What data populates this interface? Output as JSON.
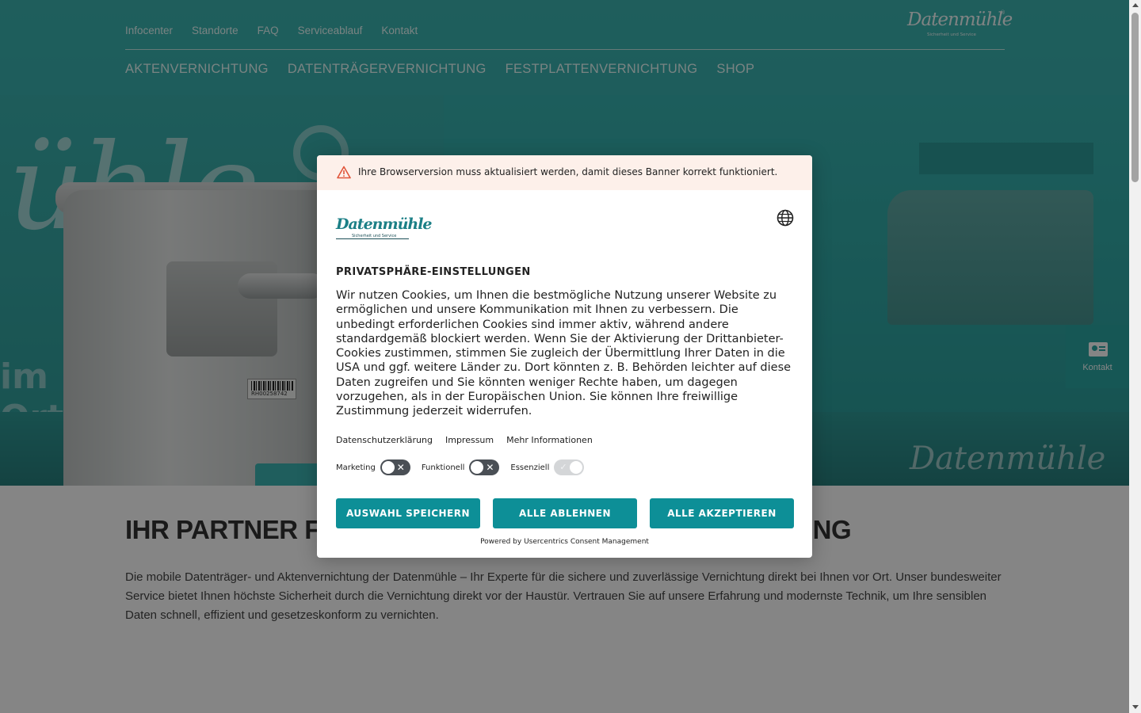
{
  "header": {
    "meta_nav": [
      "Infocenter",
      "Standorte",
      "FAQ",
      "Serviceablauf",
      "Kontakt"
    ],
    "main_nav": [
      "AKTENVERNICHTUNG",
      "DATENTRÄGERVERNICHTUNG",
      "FESTPLATTENVERNICHTUNG",
      "SHOP"
    ],
    "logo": {
      "name": "Datenmühle",
      "tagline": "Sicherheit und Service",
      "reg": "®"
    }
  },
  "hero": {
    "brand_script": "ühle",
    "brand_small": "Datenmühle",
    "side_text": [
      "im U",
      "Ort in"
    ],
    "barcode_text": "RH00258742"
  },
  "content": {
    "title": "IHR PARTNER FÜR MOBILE DATENTRÄGERVERNICHTUNG",
    "text": "Die mobile Datenträger- und Aktenvernichtung der Datenmühle – Ihr Experte für die sichere und zuverlässige Vernichtung direkt bei Ihnen vor Ort. Unser bundesweiter Service bietet Ihnen höchste Sicherheit durch die Vernichtung direkt vor der Haustür. Vertrauen Sie auf unsere Erfahrung und modernste Technik, um Ihre sensiblen Daten schnell, effizient und gesetzeskonform zu vernichten."
  },
  "contact_tab": {
    "label": "Kontakt",
    "icon": "contact-card-icon"
  },
  "consent": {
    "warning": "Ihre Browserversion muss aktualisiert werden, damit dieses Banner korrekt funktioniert.",
    "logo": {
      "name": "Datenmühle",
      "tagline": "Sicherheit und Service"
    },
    "title": "PRIVATSPHÄRE-EINSTELLUNGEN",
    "body": "Wir nutzen Cookies, um Ihnen die bestmögliche Nutzung unserer Website zu ermöglichen und unsere Kommunikation mit Ihnen zu verbessern. Die unbedingt erforderlichen Cookies sind immer aktiv, während andere standardgemäß blockiert werden. Wenn Sie der Aktivierung der Drittanbieter-Cookies zustimmen, stimmen Sie zugleich der Übermittlung Ihrer Daten in die USA und ggf. weitere Länder zu. Dort könnten z. B. Behörden leichter auf diese Daten zugreifen und Sie könnten weniger Rechte haben, um dagegen vorzugehen, als in der Europäischen Union. Sie können Ihre freiwillige Zustimmung jederzeit widerrufen.",
    "links": [
      "Datenschutzerklärung",
      "Impressum",
      "Mehr Informationen"
    ],
    "toggles": [
      {
        "label": "Marketing",
        "state": "off",
        "mark": "✕"
      },
      {
        "label": "Funktionell",
        "state": "off",
        "mark": "✕"
      },
      {
        "label": "Essenziell",
        "state": "on (disabled)",
        "mark": "✓"
      }
    ],
    "buttons": {
      "save": "AUSWAHL SPEICHERN",
      "deny": "ALLE ABLEHNEN",
      "accept": "ALLE AKZEPTIEREN"
    },
    "powered_by": "Powered by Usercentrics Consent Management",
    "colors": {
      "accent": "#0d8f97",
      "warning_bg": "#fdf0ea",
      "warning_icon": "#e0553a"
    }
  }
}
